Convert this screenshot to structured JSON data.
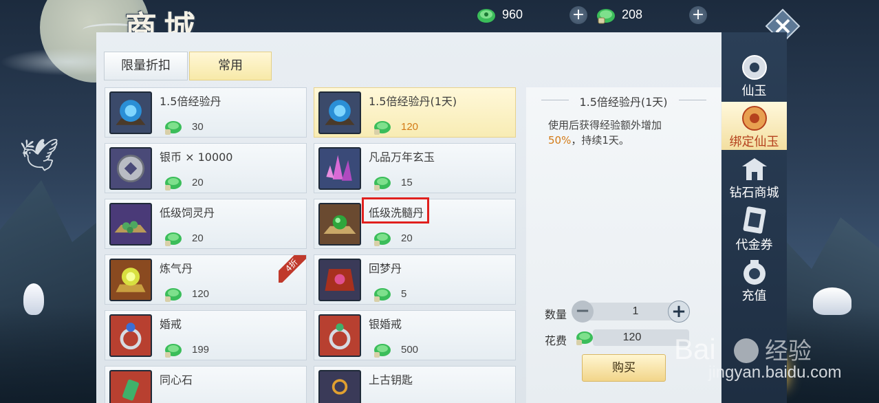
{
  "header": {
    "title": "商城",
    "currencies": [
      {
        "value": "960",
        "icon": "jade-icon"
      },
      {
        "value": "208",
        "icon": "bound-jade-icon"
      }
    ],
    "add_label": "+",
    "close_label": "✕"
  },
  "tabs": [
    {
      "label": "限量折扣",
      "active": false
    },
    {
      "label": "常用",
      "active": true
    }
  ],
  "items": [
    {
      "name": "1.5倍经验丹",
      "price": "30"
    },
    {
      "name": "1.5倍经验丹(1天)",
      "price": "120",
      "selected": true
    },
    {
      "name": "银币 × 10000",
      "price": "20"
    },
    {
      "name": "凡品万年玄玉",
      "price": "15"
    },
    {
      "name": "低级饲灵丹",
      "price": "20"
    },
    {
      "name": "低级洗髓丹",
      "price": "20"
    },
    {
      "name": "炼气丹",
      "price": "120",
      "badge": "4折"
    },
    {
      "name": "回梦丹",
      "price": "5"
    },
    {
      "name": "婚戒",
      "price": "199"
    },
    {
      "name": "银婚戒",
      "price": "500"
    },
    {
      "name": "同心石",
      "price": ""
    },
    {
      "name": "上古钥匙",
      "price": ""
    }
  ],
  "detail": {
    "title": "1.5倍经验丹(1天)",
    "desc_prefix": "使用后获得经验额外增加",
    "desc_pct": "50%",
    "desc_suffix": "，持续1天。",
    "qty_label": "数量",
    "qty_value": "1",
    "cost_label": "花费",
    "cost_value": "120",
    "buy_label": "购买"
  },
  "sidebar": [
    {
      "label": "仙玉",
      "active": false
    },
    {
      "label": "绑定仙玉",
      "active": true
    },
    {
      "label": "钻石商城",
      "active": false
    },
    {
      "label": "代金券",
      "active": false
    },
    {
      "label": "充值",
      "active": false
    }
  ],
  "watermark": {
    "brand": "Bai 经验",
    "url": "jingyan.baidu.com"
  },
  "colors": {
    "accent": "#d37a16",
    "selected_bg": "#f8ecb4",
    "highlight": "#e0201e"
  }
}
